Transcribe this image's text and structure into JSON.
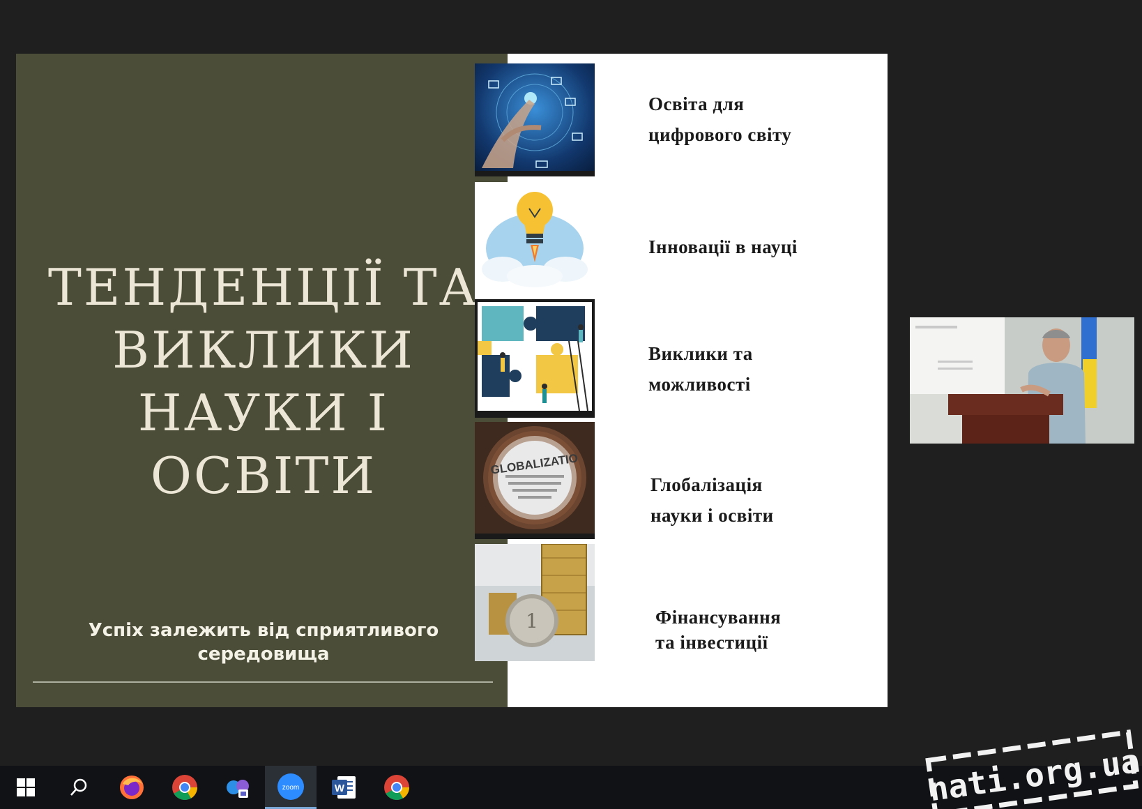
{
  "slide": {
    "title_lines": [
      "ТЕНДЕНЦІЇ ТА",
      "ВИКЛИКИ",
      "НАУКИ І",
      "ОСВІТИ"
    ],
    "subtitle_lines": [
      "Успіх залежить від сприятливого",
      "середовища"
    ],
    "topics": [
      {
        "lines": [
          "Освіта для",
          "цифрового світу"
        ],
        "image": "digital-hand-network"
      },
      {
        "lines": [
          "Інновації в науці"
        ],
        "image": "lightbulb-rocket"
      },
      {
        "lines": [
          "Виклики та",
          "можливості"
        ],
        "image": "puzzle-pieces-people"
      },
      {
        "lines": [
          "Глобалізація",
          "науки і освіти"
        ],
        "image": "globalization-word-sphere",
        "globe_text": "GLOBALIZATIO"
      },
      {
        "lines": [
          "Фінансування",
          "та інвестиції"
        ],
        "image": "coin-stacks"
      }
    ]
  },
  "webcam": {
    "content": "presenter-at-podium-with-ukrainian-flag"
  },
  "taskbar": {
    "items": [
      {
        "name": "windows-start",
        "icon": "windows-logo-icon"
      },
      {
        "name": "search",
        "icon": "search-icon"
      },
      {
        "name": "firefox",
        "icon": "firefox-icon"
      },
      {
        "name": "chrome",
        "icon": "chrome-icon"
      },
      {
        "name": "teams",
        "icon": "teams-icon"
      },
      {
        "name": "zoom",
        "icon": "zoom-icon",
        "label": "zoom",
        "active": true
      },
      {
        "name": "word",
        "icon": "word-icon",
        "label": "W"
      },
      {
        "name": "chrome-2",
        "icon": "chrome-icon"
      }
    ]
  },
  "watermark": {
    "text": "nati.org.ua"
  },
  "colors": {
    "slide_left_bg": "#4b4d38",
    "slide_title": "#ece6d6",
    "taskbar_bg": "#101216",
    "zoom_blue": "#2d8cff",
    "word_blue": "#2b579a"
  }
}
